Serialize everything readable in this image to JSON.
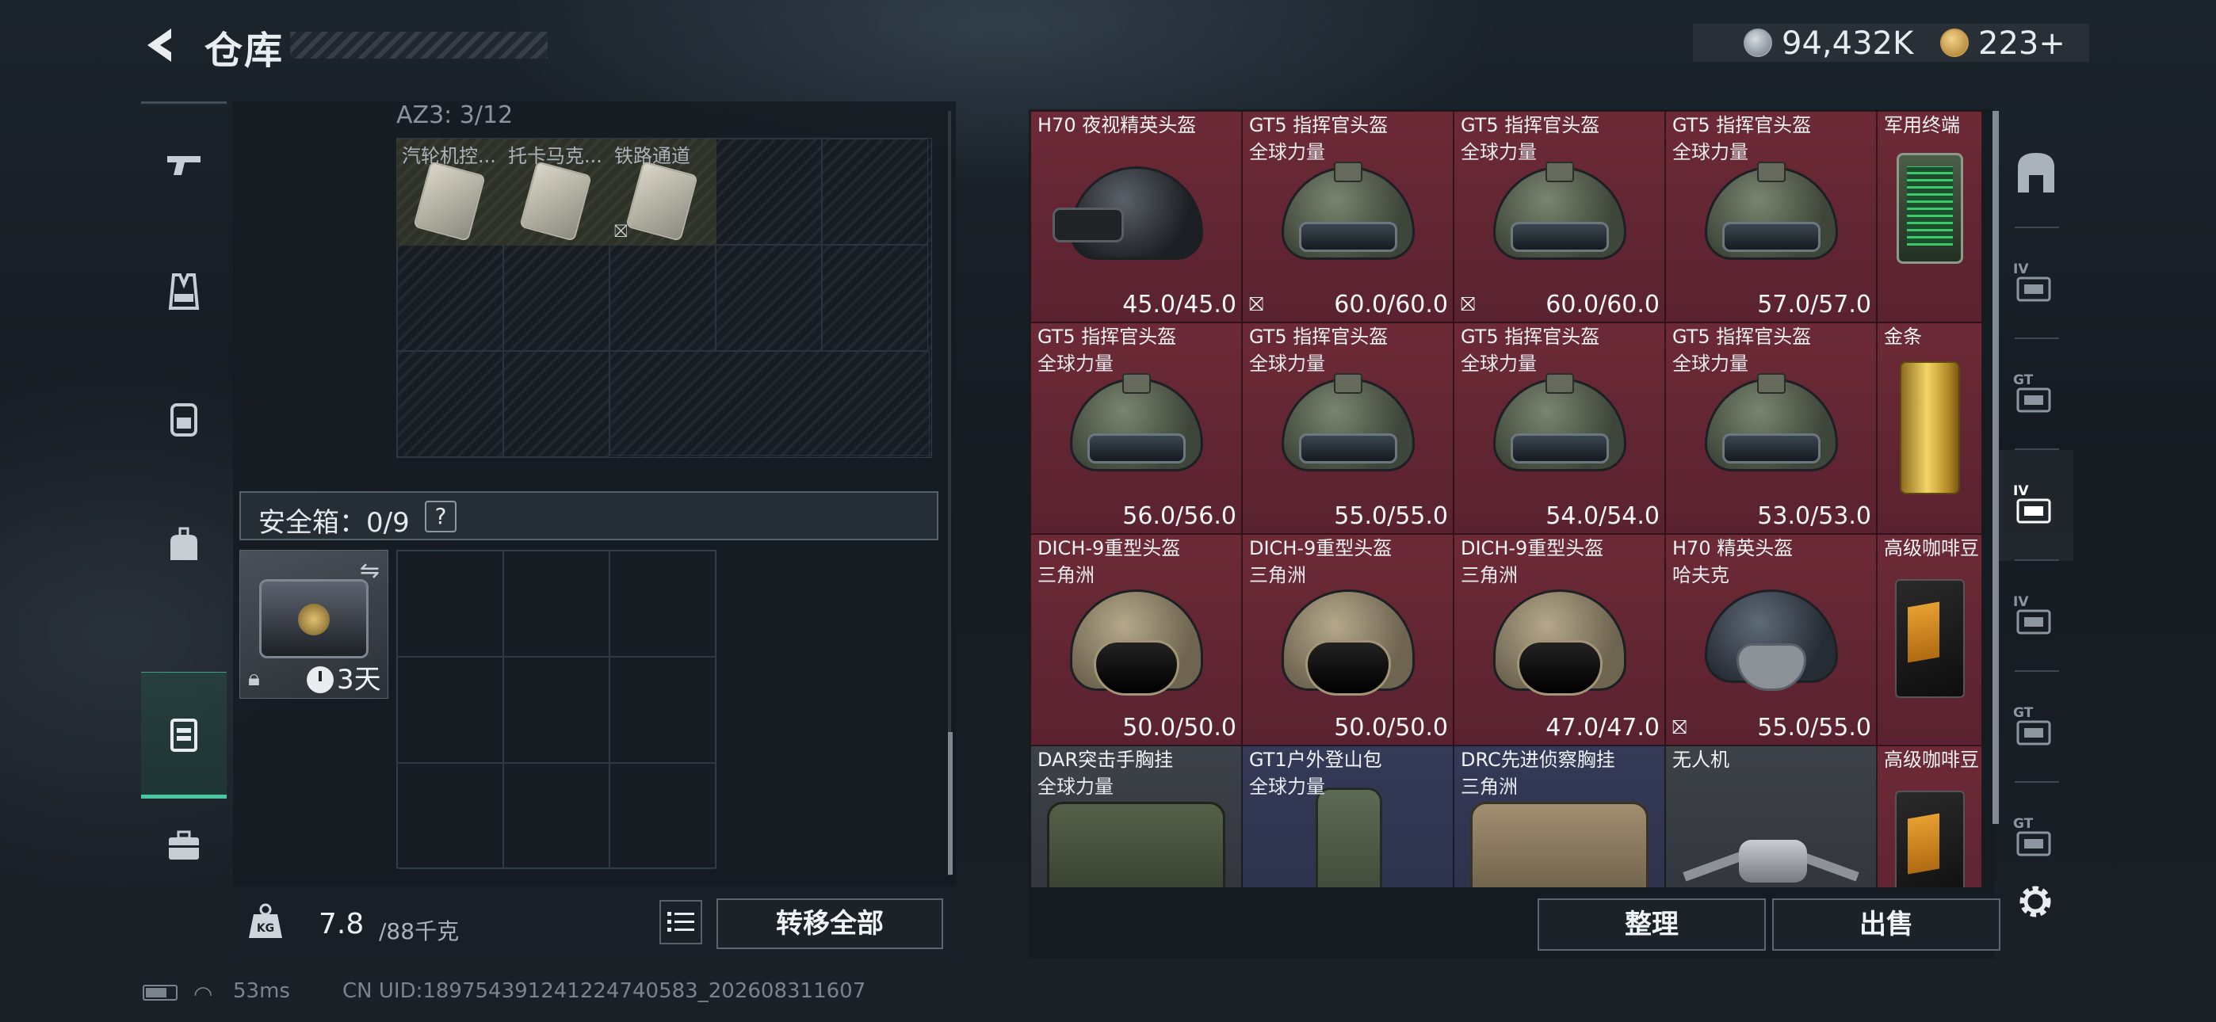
{
  "header": {
    "title": "仓库",
    "currency_silver": "94,432K",
    "currency_gold": "223",
    "gold_add": "+"
  },
  "rail": {
    "items": [
      {
        "icon": "pistol-icon"
      },
      {
        "icon": "vest-icon"
      },
      {
        "icon": "backpack-icon"
      },
      {
        "icon": "bag-icon"
      },
      {
        "icon": "container-icon",
        "active": true
      },
      {
        "icon": "briefcase-icon"
      }
    ]
  },
  "left": {
    "az_label": "AZ3: 3/12",
    "az_items": [
      {
        "name": "汽轮机控..."
      },
      {
        "name": "托卡马克..."
      },
      {
        "name": "铁路通道"
      }
    ],
    "safe_label": "安全箱：0/9",
    "safe_help": "?",
    "safe_days": "3天",
    "weight_value": "7.8",
    "weight_max": "/88千克",
    "transfer_all": "转移全部"
  },
  "status": {
    "ping": "53ms",
    "uid": "CN UID:18975439124122474058​3_202608311607"
  },
  "items": [
    {
      "name": "H70 夜视精英头盔",
      "sub": "",
      "dur": "45.0/45.0",
      "color": "red",
      "icon": "helmet-black",
      "no_insure": false
    },
    {
      "name": "GT5 指挥官头盔",
      "sub": "全球力量",
      "dur": "60.0/60.0",
      "color": "red",
      "icon": "helmet-green",
      "no_insure": true
    },
    {
      "name": "GT5 指挥官头盔",
      "sub": "全球力量",
      "dur": "60.0/60.0",
      "color": "red",
      "icon": "helmet-green",
      "no_insure": true
    },
    {
      "name": "GT5 指挥官头盔",
      "sub": "全球力量",
      "dur": "57.0/57.0",
      "color": "red",
      "icon": "helmet-green",
      "no_insure": false
    },
    {
      "name": "军用终端",
      "sub": "",
      "dur": "",
      "color": "red",
      "icon": "terminal",
      "no_insure": false,
      "narrow": true
    },
    {
      "name": "GT5 指挥官头盔",
      "sub": "全球力量",
      "dur": "56.0/56.0",
      "color": "red",
      "icon": "helmet-green",
      "no_insure": false
    },
    {
      "name": "GT5 指挥官头盔",
      "sub": "全球力量",
      "dur": "55.0/55.0",
      "color": "red",
      "icon": "helmet-green",
      "no_insure": false
    },
    {
      "name": "GT5 指挥官头盔",
      "sub": "全球力量",
      "dur": "54.0/54.0",
      "color": "red",
      "icon": "helmet-green",
      "no_insure": false
    },
    {
      "name": "GT5 指挥官头盔",
      "sub": "全球力量",
      "dur": "53.0/53.0",
      "color": "red",
      "icon": "helmet-green",
      "no_insure": false
    },
    {
      "name": "金条",
      "sub": "",
      "dur": "",
      "color": "red",
      "icon": "gold-bar",
      "no_insure": false,
      "narrow": true
    },
    {
      "name": "DICH-9重型头盔",
      "sub": "三角洲",
      "dur": "50.0/50.0",
      "color": "red",
      "icon": "helmet-tan",
      "no_insure": false
    },
    {
      "name": "DICH-9重型头盔",
      "sub": "三角洲",
      "dur": "50.0/50.0",
      "color": "red",
      "icon": "helmet-tan",
      "no_insure": false
    },
    {
      "name": "DICH-9重型头盔",
      "sub": "三角洲",
      "dur": "47.0/47.0",
      "color": "red",
      "icon": "helmet-tan",
      "no_insure": false
    },
    {
      "name": "H70 精英头盔",
      "sub": "哈夫克",
      "dur": "55.0/55.0",
      "color": "red",
      "icon": "helmet-grey",
      "no_insure": true
    },
    {
      "name": "高级咖啡豆",
      "sub": "",
      "dur": "",
      "color": "red",
      "icon": "coffee",
      "no_insure": false,
      "narrow": true
    },
    {
      "name": "DAR突击手胸挂",
      "sub": "全球力量",
      "dur": "",
      "color": "grey",
      "icon": "vest",
      "no_insure": false
    },
    {
      "name": "GT1户外登山包",
      "sub": "全球力量",
      "dur": "",
      "color": "blue",
      "icon": "pack",
      "no_insure": false
    },
    {
      "name": "DRC先进侦察胸挂",
      "sub": "三角洲",
      "dur": "",
      "color": "blue",
      "icon": "vest-tan",
      "no_insure": false
    },
    {
      "name": "无人机",
      "sub": "",
      "dur": "",
      "color": "grey",
      "icon": "drone",
      "no_insure": false
    },
    {
      "name": "高级咖啡豆",
      "sub": "",
      "dur": "",
      "color": "red",
      "icon": "coffee",
      "no_insure": false,
      "narrow": true
    }
  ],
  "filters": [
    {
      "icon": "all-items-icon",
      "label": ""
    },
    {
      "icon": "tier4-helmet-filter-icon",
      "label": "IV"
    },
    {
      "icon": "gt-vest-filter-icon",
      "label": "GT"
    },
    {
      "icon": "tier4-armor-filter-icon",
      "label": "IV",
      "active": true
    },
    {
      "icon": "tier4-bag-filter-icon",
      "label": "IV"
    },
    {
      "icon": "gt-filter-icon",
      "label": "GT"
    },
    {
      "icon": "gt-pack-filter-icon",
      "label": "GT"
    }
  ],
  "buttons": {
    "sort": "整理",
    "sell": "出售"
  }
}
